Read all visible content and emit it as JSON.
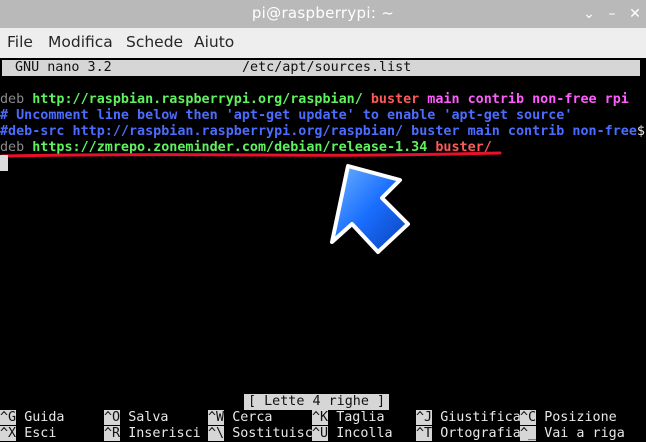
{
  "window": {
    "title": "pi@raspberrypi: ~",
    "chevron": "⌄",
    "minimize": "–",
    "close": "✕"
  },
  "menu": [
    "File",
    "Modifica",
    "Schede",
    "Aiuto"
  ],
  "nano": {
    "version": "GNU nano 3.2",
    "file": "/etc/apt/sources.list"
  },
  "lines": [
    [
      {
        "t": "deb ",
        "c": "gray"
      },
      {
        "t": "http://raspbian.raspberrypi.org/raspbian/ ",
        "c": "green"
      },
      {
        "t": "buster ",
        "c": "red"
      },
      {
        "t": "main contrib non-free rpi",
        "c": "mag"
      }
    ],
    [
      {
        "t": "# Uncomment line below then 'apt-get update' to enable 'apt-get source'",
        "c": "blue"
      }
    ],
    [
      {
        "t": "#deb-src http://raspbian.raspberrypi.org/raspbian/ buster main contrib non-free",
        "c": "blue"
      },
      {
        "t": "$",
        "c": "white"
      }
    ],
    [
      {
        "t": "deb ",
        "c": "gray"
      },
      {
        "t": "https://zmrepo.zoneminder.com/debian/release-1.34 ",
        "c": "green"
      },
      {
        "t": "buster/",
        "c": "red"
      }
    ]
  ],
  "status": "[ Lette 4 righe ]",
  "shortcuts": {
    "row1": [
      {
        "k": "^G",
        "l": "Guida"
      },
      {
        "k": "^O",
        "l": "Salva"
      },
      {
        "k": "^W",
        "l": "Cerca"
      },
      {
        "k": "^K",
        "l": "Taglia"
      },
      {
        "k": "^J",
        "l": "Giustifica"
      },
      {
        "k": "^C",
        "l": "Posizione"
      }
    ],
    "row2": [
      {
        "k": "^X",
        "l": "Esci"
      },
      {
        "k": "^R",
        "l": "Inserisci"
      },
      {
        "k": "^\\",
        "l": "Sostituisc"
      },
      {
        "k": "^U",
        "l": "Incolla"
      },
      {
        "k": "^T",
        "l": "Ortografia"
      },
      {
        "k": "^_",
        "l": "Vai a riga"
      }
    ]
  },
  "colors": {
    "gray": "#8a8a8a",
    "green": "#5ff25f",
    "red": "#ff5858",
    "magenta": "#ff5cff",
    "blue": "#4c6cff",
    "annotation_red": "#e8102a",
    "annotation_arrow": "#1a6fff"
  },
  "icons": {
    "annotation": "arrow-icon"
  }
}
